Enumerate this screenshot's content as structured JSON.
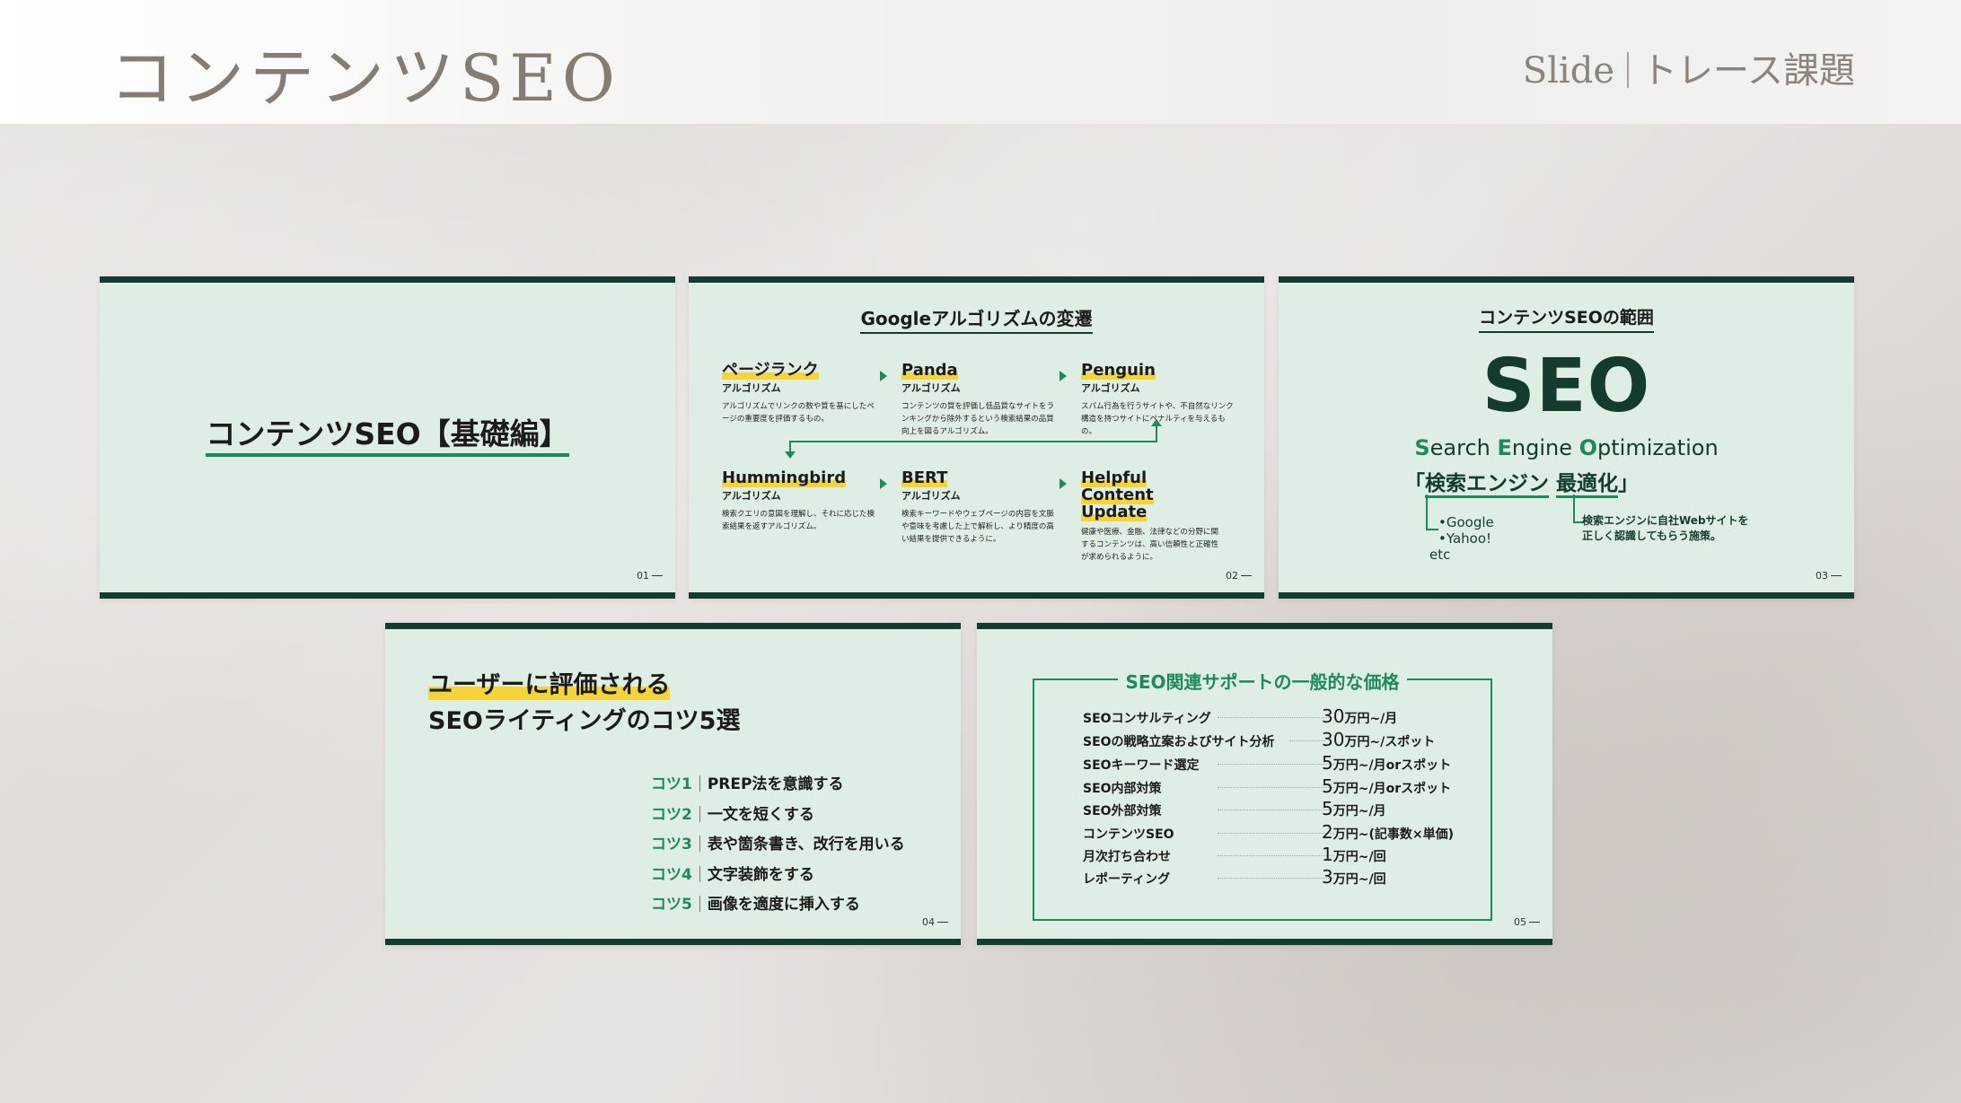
{
  "header": {
    "title": "コンテンツSEO",
    "right_en": "Slide",
    "right_jp": "トレース課題"
  },
  "slide1": {
    "title": "コンテンツSEO【基礎編】",
    "page": "01"
  },
  "slide2": {
    "title": "Googleアルゴリズムの変遷",
    "page": "02",
    "algorithms": [
      {
        "name": "ページランク",
        "sub": "アルゴリズム",
        "desc": "アルゴリズムでリンクの数や質を基にしたページの重要度を評価するもの。"
      },
      {
        "name": "Panda",
        "sub": "アルゴリズム",
        "desc": "コンテンツの質を評価し低品質なサイトをランキングから除外するという検索結果の品質向上を図るアルゴリズム。"
      },
      {
        "name": "Penguin",
        "sub": "アルゴリズム",
        "desc": "スパム行為を行うサイトや、不自然なリンク構造を持つサイトにペナルティを与えるもの。"
      },
      {
        "name": "Hummingbird",
        "sub": "アルゴリズム",
        "desc": "検索クエリの意図を理解し、それに応じた検索結果を返すアルゴリズム。"
      },
      {
        "name": "BERT",
        "sub": "アルゴリズム",
        "desc": "検索キーワードやウェブページの内容を文脈や意味を考慮した上で解析し、より精度の高い結果を提供できるように。"
      },
      {
        "name": "Helpful Content Update",
        "sub": "",
        "desc": "健康や医療、金融、法律などの分野に関するコンテンツは、高い信頼性と正確性が求められるように。"
      }
    ]
  },
  "slide3": {
    "title": "コンテンツSEOの範囲",
    "big": "SEO",
    "full": {
      "s": "S",
      "earch": "earch ",
      "e": "E",
      "ngine": "ngine ",
      "o": "O",
      "ptimization": "ptimization"
    },
    "jp_open": "「",
    "jp_a": "検索エンジン",
    "jp_b": "最適化",
    "jp_close": "」",
    "engines": [
      "•Google",
      "•Yahoo!",
      "etc"
    ],
    "note": "検索エンジンに自社Webサイトを正しく認識してもらう施策。",
    "page": "03"
  },
  "slide4": {
    "title1": "ユーザーに評価される",
    "title2": "SEOライティングのコツ5選",
    "page": "04",
    "tips": [
      {
        "key": "コツ1",
        "text": "PREP法を意識する"
      },
      {
        "key": "コツ2",
        "text": "一文を短くする"
      },
      {
        "key": "コツ3",
        "text": "表や箇条書き、改行を用いる"
      },
      {
        "key": "コツ4",
        "text": "文字装飾をする"
      },
      {
        "key": "コツ5",
        "text": "画像を適度に挿入する"
      }
    ]
  },
  "slide5": {
    "title": "SEO関連サポートの一般的な価格",
    "page": "05",
    "rows": [
      {
        "label": "SEOコンサルティング",
        "num": "30",
        "unit": "万円~/月"
      },
      {
        "label": "SEOの戦略立案およびサイト分析",
        "num": "30",
        "unit": "万円~/スポット"
      },
      {
        "label": "SEOキーワード選定",
        "num": "5",
        "unit": "万円~/月orスポット"
      },
      {
        "label": "SEO内部対策",
        "num": "5",
        "unit": "万円~/月orスポット"
      },
      {
        "label": "SEO外部対策",
        "num": "5",
        "unit": "万円~/月"
      },
      {
        "label": "コンテンツSEO",
        "num": "2",
        "unit": "万円~(記事数×単価)"
      },
      {
        "label": "月次打ち合わせ",
        "num": "1",
        "unit": "万円~/回"
      },
      {
        "label": "レポーティング",
        "num": "3",
        "unit": "万円~/回"
      }
    ]
  }
}
